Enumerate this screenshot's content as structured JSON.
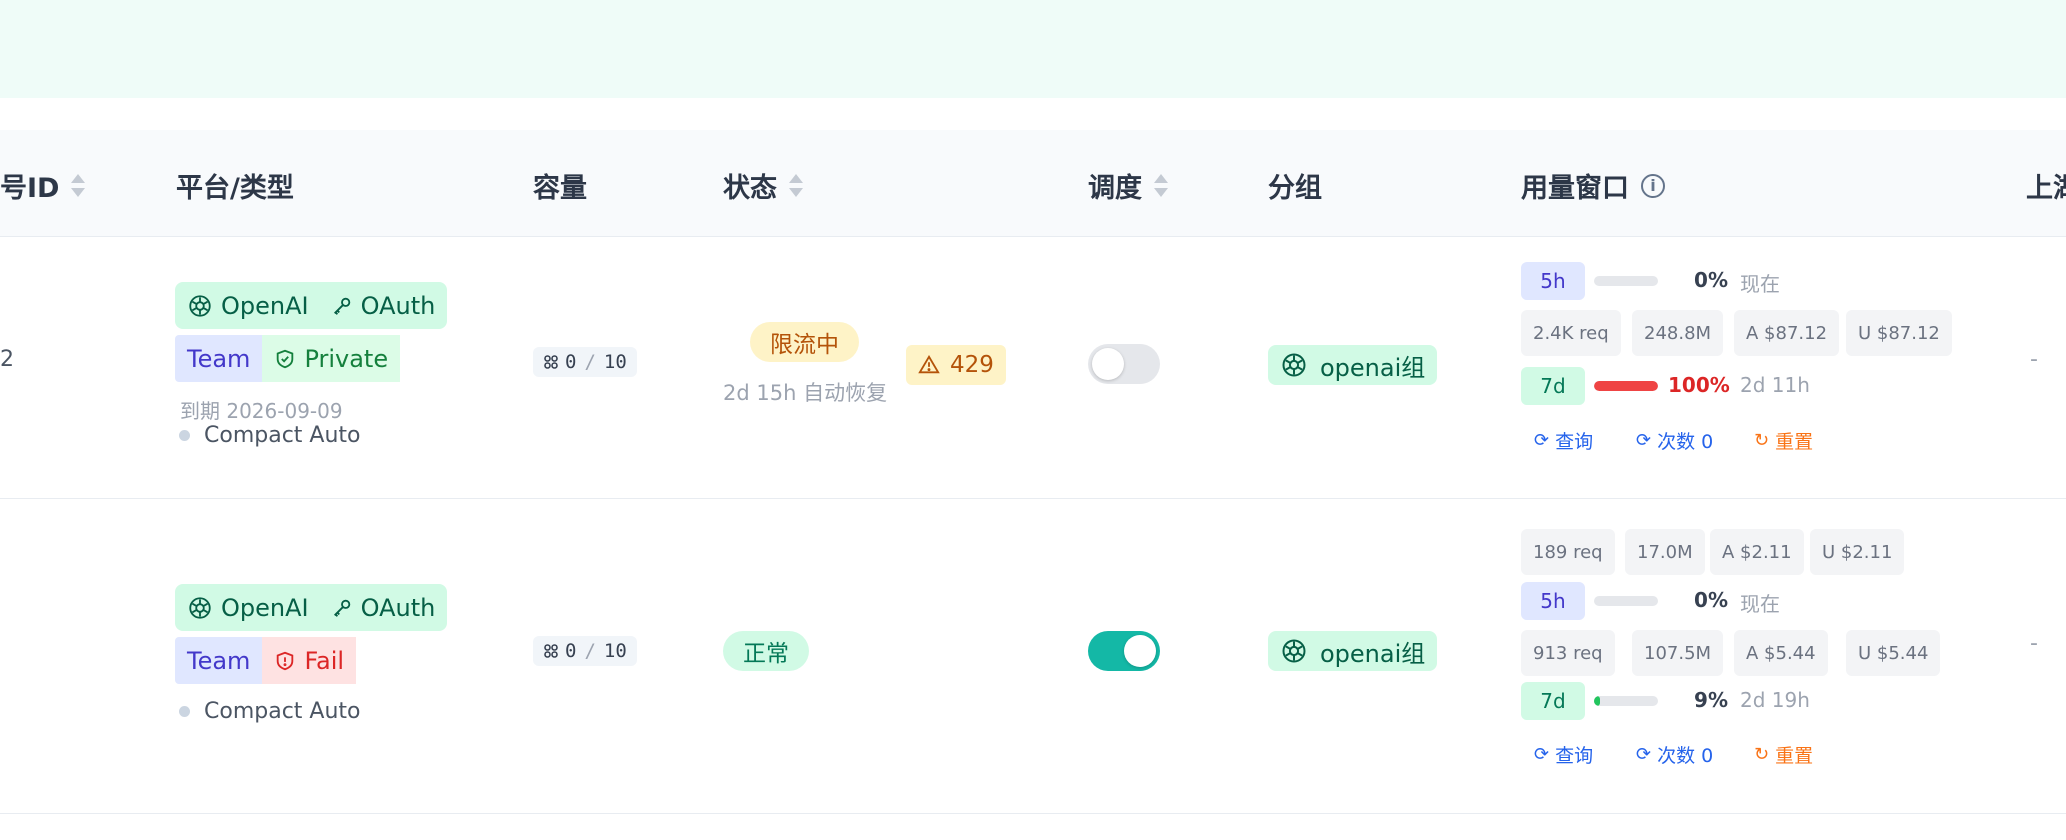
{
  "header": {
    "columns": [
      {
        "label": "号ID",
        "sortable": true
      },
      {
        "label": "平台/类型",
        "sortable": false
      },
      {
        "label": "容量",
        "sortable": false
      },
      {
        "label": "状态",
        "sortable": true
      },
      {
        "label": "调度",
        "sortable": true
      },
      {
        "label": "分组",
        "sortable": false
      },
      {
        "label": "用量窗口",
        "sortable": false,
        "info": true
      },
      {
        "label": "上湖",
        "sortable": false
      }
    ]
  },
  "rows": [
    {
      "id_fragment": "2",
      "platform": {
        "name": "OpenAI",
        "auth": "OAuth"
      },
      "plan": {
        "label": "Team",
        "privacy": "Private",
        "privacy_type": "private"
      },
      "expiry": "到期 2026-09-09",
      "mode": "Compact Auto",
      "capacity": {
        "used": "0",
        "total": "10"
      },
      "status": {
        "label": "限流中",
        "sub": "2d 15h 自动恢复",
        "kind": "limited"
      },
      "warning": "429",
      "schedule_enabled": false,
      "group": "openai组",
      "usage": {
        "five_h": {
          "label": "5h",
          "pct": "0%",
          "fill": 0,
          "when": "现在"
        },
        "five_h_stats": {
          "req": "2.4K req",
          "tokens": "248.8M",
          "a": "A $87.12",
          "u": "U $87.12"
        },
        "seven_d": {
          "label": "7d",
          "pct": "100%",
          "fill": 100,
          "when": "2d 11h"
        }
      },
      "actions": {
        "query": "查询",
        "count": "次数 0",
        "reset": "重置"
      },
      "upstream": "-"
    },
    {
      "id_fragment": "",
      "platform": {
        "name": "OpenAI",
        "auth": "OAuth"
      },
      "plan": {
        "label": "Team",
        "privacy": "Fail",
        "privacy_type": "fail"
      },
      "mode": "Compact Auto",
      "capacity": {
        "used": "0",
        "total": "10"
      },
      "status": {
        "label": "正常",
        "kind": "ok"
      },
      "schedule_enabled": true,
      "group": "openai组",
      "usage": {
        "five_h_stats": {
          "req": "189 req",
          "tokens": "17.0M",
          "a": "A $2.11",
          "u": "U $2.11"
        },
        "five_h": {
          "label": "5h",
          "pct": "0%",
          "fill": 0,
          "when": "现在"
        },
        "seven_d_stats": {
          "req": "913 req",
          "tokens": "107.5M",
          "a": "A $5.44",
          "u": "U $5.44"
        },
        "seven_d": {
          "label": "7d",
          "pct": "9%",
          "fill": 9,
          "when": "2d 19h"
        }
      },
      "actions": {
        "query": "查询",
        "count": "次数 0",
        "reset": "重置"
      },
      "upstream": "-"
    }
  ],
  "colors": {
    "accent_green": "#14b8a6",
    "bar_red": "#ef4444",
    "bar_green": "#22c55e",
    "link_blue": "#2563eb",
    "reset_orange": "#f97316"
  },
  "icons": [
    "openai-icon",
    "key-icon",
    "shield-check-icon",
    "shield-x-icon",
    "capacity-icon",
    "warning-icon",
    "info-icon",
    "sort-icon",
    "refresh-icon",
    "reset-icon"
  ]
}
